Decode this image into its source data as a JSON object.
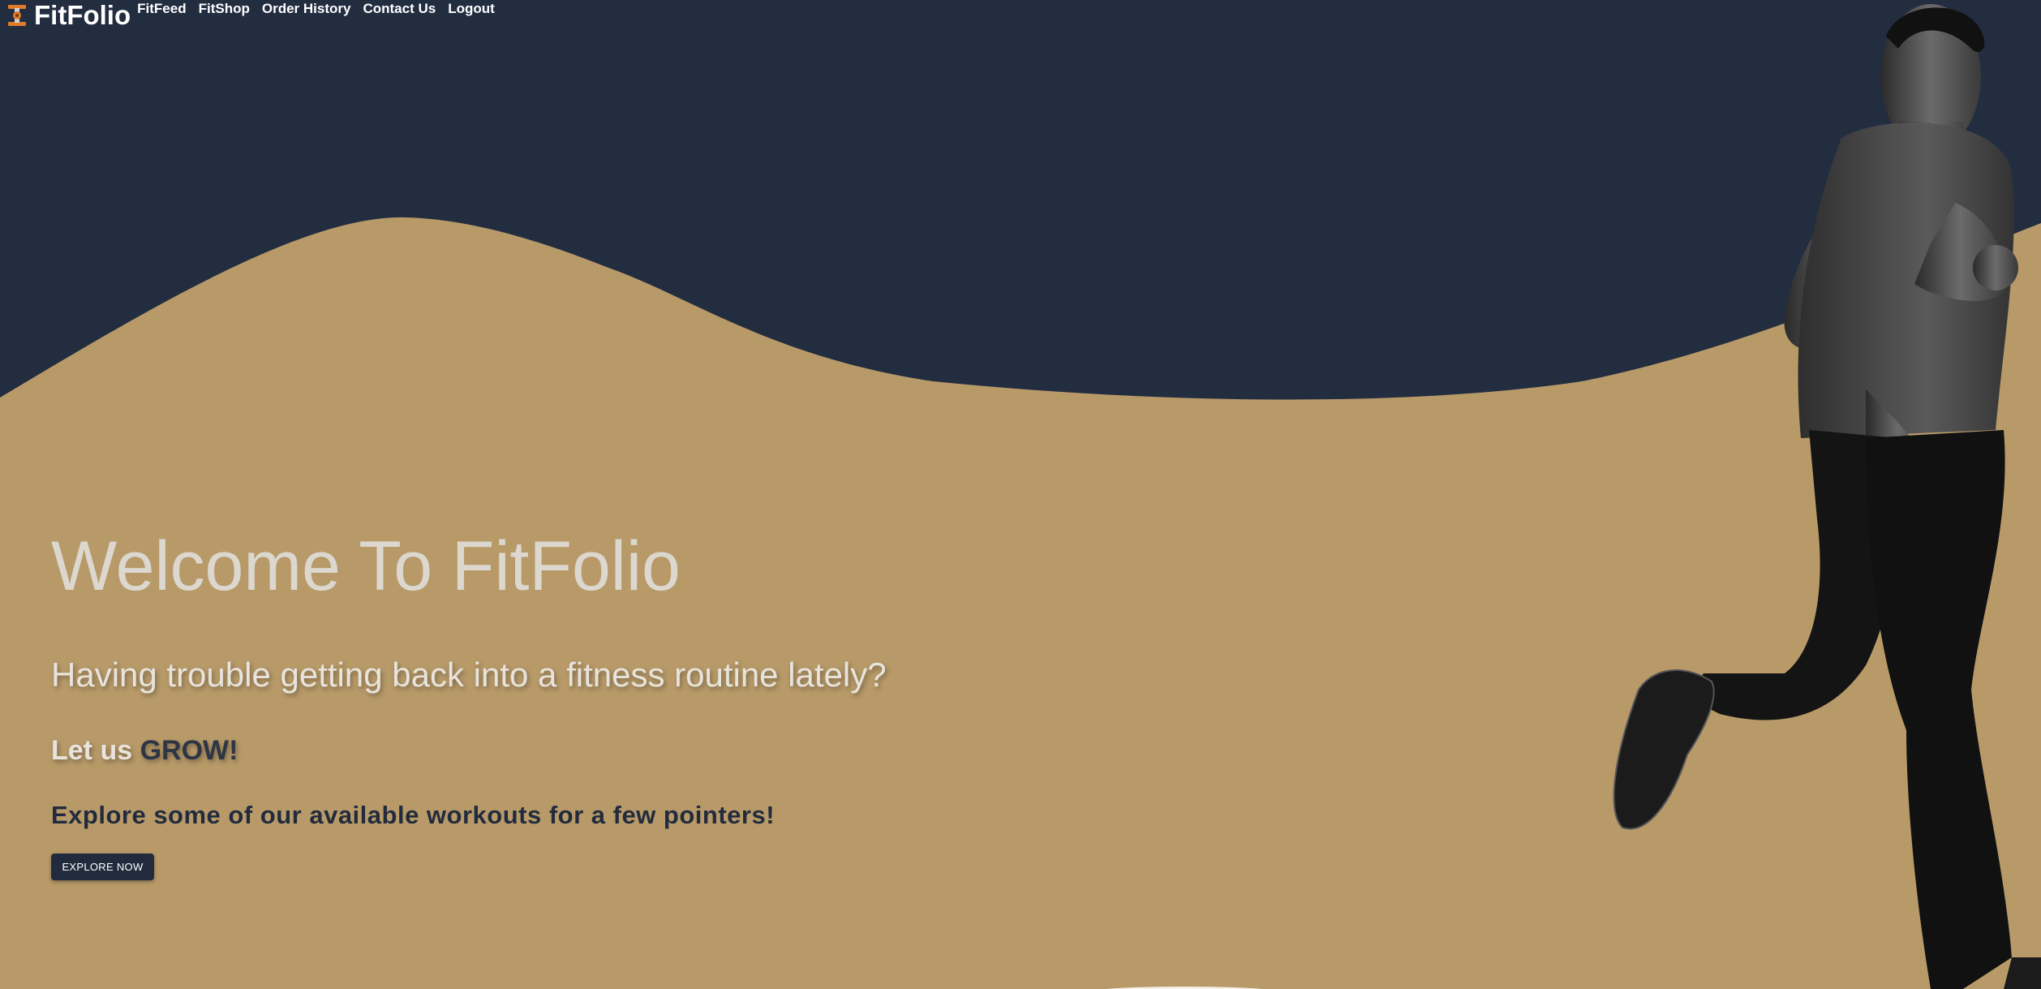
{
  "app": {
    "brand": "FitFolio",
    "brand_icon": "dumbbell-icon"
  },
  "nav": {
    "links": [
      "FitFeed",
      "FitShop",
      "Order History",
      "Contact Us",
      "Logout"
    ]
  },
  "hero": {
    "title": "Welcome To FitFolio",
    "question": "Having trouble getting back into a fitness routine lately?",
    "grow_prefix": "Let us ",
    "grow_accent": "GROW!",
    "explore": "Explore some of our available workouts for a few pointers!",
    "cta_label": "EXPLORE NOW"
  },
  "colors": {
    "navy": "#232d40",
    "tan": "#b89a69",
    "button": "#222b3d"
  },
  "images": {
    "hero_image": "running-athlete"
  }
}
